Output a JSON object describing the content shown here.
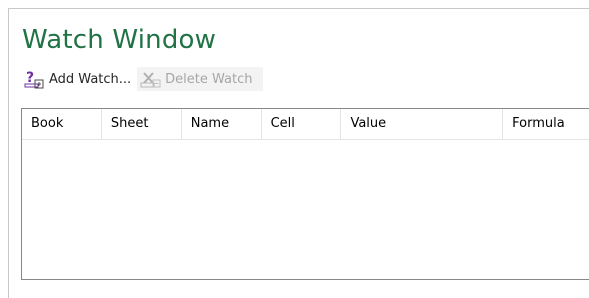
{
  "window": {
    "title": "Watch Window"
  },
  "toolbar": {
    "add_label": "Add Watch...",
    "add_icon": "add-watch-icon",
    "delete_label": "Delete Watch",
    "delete_icon": "delete-watch-icon",
    "delete_enabled": false
  },
  "table": {
    "columns": [
      "Book",
      "Sheet",
      "Name",
      "Cell",
      "Value",
      "Formula"
    ],
    "rows": []
  },
  "colors": {
    "title": "#217346",
    "disabled_text": "#a6a6a6",
    "add_icon_accent": "#7030a0"
  }
}
